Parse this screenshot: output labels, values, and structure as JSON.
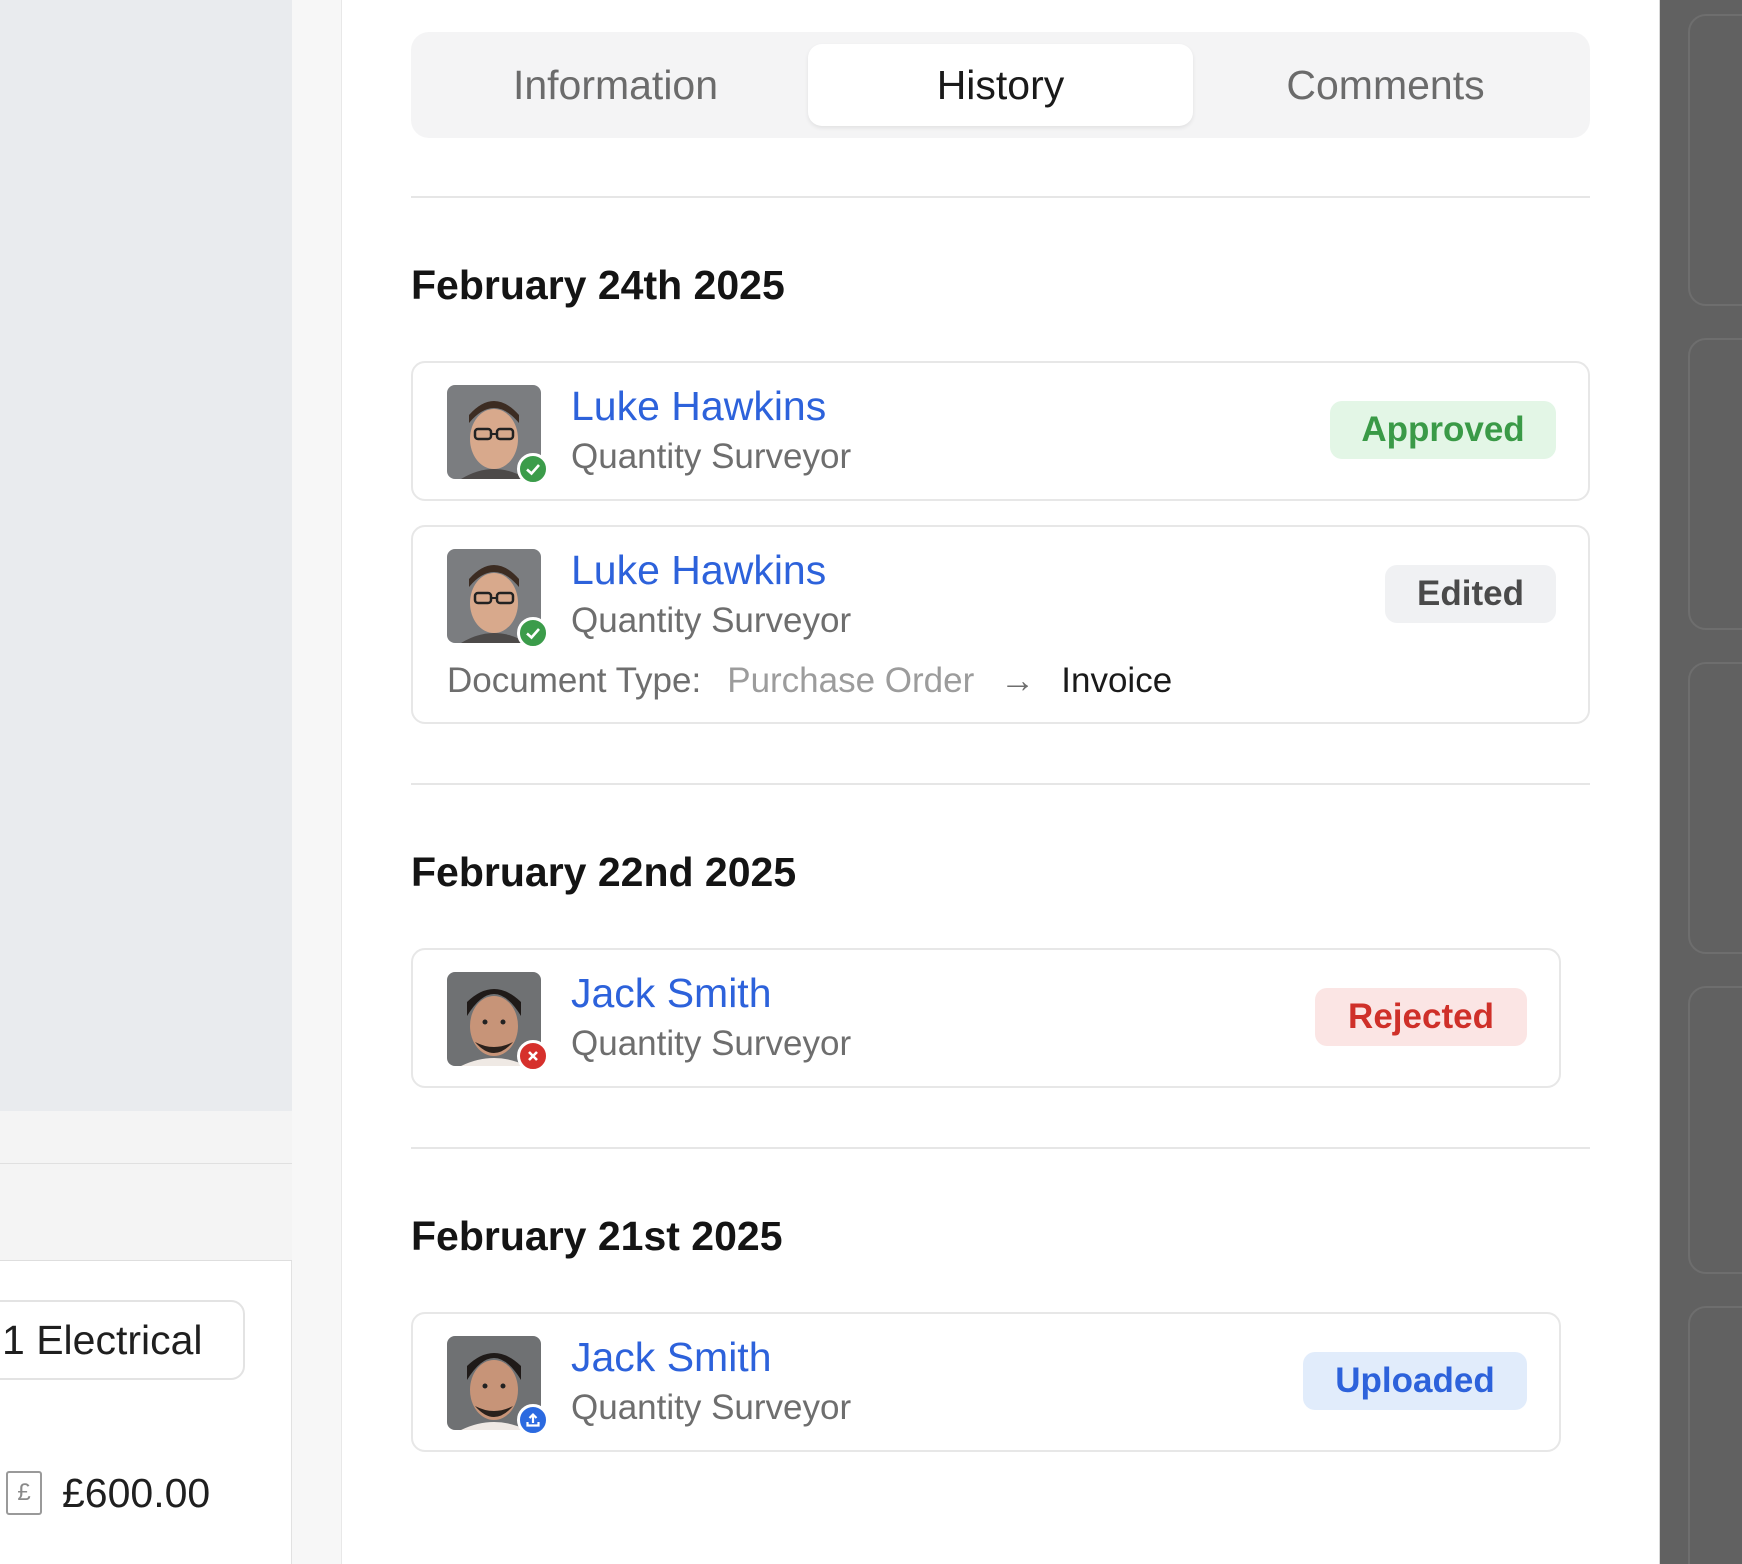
{
  "tabs": [
    {
      "label": "Information",
      "active": false
    },
    {
      "label": "History",
      "active": true
    },
    {
      "label": "Comments",
      "active": false
    }
  ],
  "left_panel": {
    "chip_text": "1 Electrical",
    "currency_icon": "pound-receipt-icon",
    "amount": "£600.00"
  },
  "groups": [
    {
      "date": "February 24th 2025",
      "entries": [
        {
          "name": "Luke Hawkins",
          "role": "Quantity Surveyor",
          "status": "Approved",
          "badge": "check-icon"
        },
        {
          "name": "Luke Hawkins",
          "role": "Quantity Surveyor",
          "status": "Edited",
          "badge": "check-icon",
          "change": {
            "label": "Document Type:",
            "from": "Purchase Order",
            "arrow": "→",
            "to": "Invoice"
          }
        }
      ]
    },
    {
      "date": "February 22nd 2025",
      "entries": [
        {
          "name": "Jack Smith",
          "role": "Quantity Surveyor",
          "status": "Rejected",
          "badge": "x-icon"
        }
      ]
    },
    {
      "date": "February 21st 2025",
      "entries": [
        {
          "name": "Jack Smith",
          "role": "Quantity Surveyor",
          "status": "Uploaded",
          "badge": "upload-icon"
        }
      ]
    }
  ],
  "colors": {
    "link": "#2d62db",
    "approved": "#3a9a47",
    "rejected": "#cf3029",
    "uploaded": "#2d62db"
  }
}
